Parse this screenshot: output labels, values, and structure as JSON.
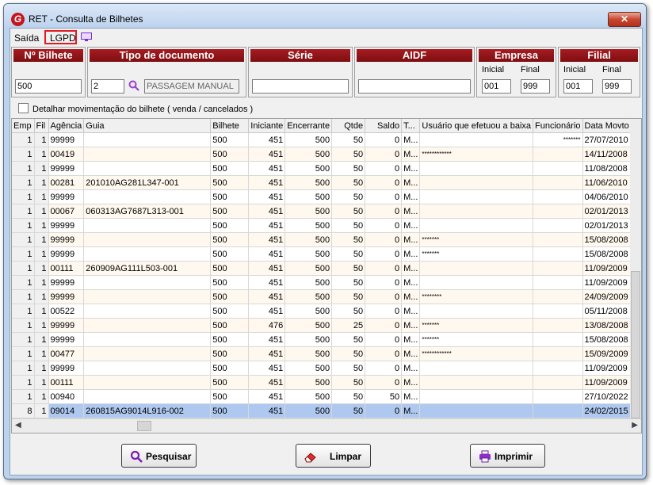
{
  "window": {
    "title": "RET - Consulta de Bilhetes",
    "close_label": "✕"
  },
  "menu": {
    "saida": "Saída",
    "lgpd": "LGPD"
  },
  "filters": {
    "bilhete": {
      "label": "Nº Bilhete",
      "value": "500"
    },
    "tipo_doc": {
      "label": "Tipo de documento",
      "code": "2",
      "description": "PASSAGEM MANUAL"
    },
    "serie": {
      "label": "Série",
      "value": ""
    },
    "aidf": {
      "label": "AIDF",
      "value": ""
    },
    "empresa": {
      "label": "Empresa",
      "inicial_label": "Inicial",
      "final_label": "Final",
      "inicial": "001",
      "final": "999"
    },
    "filial": {
      "label": "Filial",
      "inicial_label": "Inicial",
      "final_label": "Final",
      "inicial": "001",
      "final": "999"
    }
  },
  "detail_checkbox": {
    "label": "Detalhar movimentação do bilhete ( venda / cancelados )",
    "checked": false
  },
  "grid": {
    "columns": [
      "Emp",
      "Fil",
      "Agência",
      "Guia",
      "Bilhete",
      "Iniciante",
      "Encerrante",
      "Qtde",
      "Saldo",
      "T...",
      "Usuário que efetuou a baixa",
      "Funcionário",
      "Data Movto"
    ],
    "rows": [
      [
        "1",
        "1",
        "99999",
        "",
        "500",
        "451",
        "500",
        "50",
        "0",
        "M...",
        "",
        "*******",
        "27/07/2010"
      ],
      [
        "1",
        "1",
        "00419",
        "",
        "500",
        "451",
        "500",
        "50",
        "0",
        "M...",
        "************",
        "",
        "14/11/2008"
      ],
      [
        "1",
        "1",
        "99999",
        "",
        "500",
        "451",
        "500",
        "50",
        "0",
        "M...",
        "",
        "",
        "11/08/2008"
      ],
      [
        "1",
        "1",
        "00281",
        "201010AG281L347-001",
        "500",
        "451",
        "500",
        "50",
        "0",
        "M...",
        "",
        "",
        "11/06/2010"
      ],
      [
        "1",
        "1",
        "99999",
        "",
        "500",
        "451",
        "500",
        "50",
        "0",
        "M...",
        "",
        "",
        "04/06/2010"
      ],
      [
        "1",
        "1",
        "00067",
        "060313AG7687L313-001",
        "500",
        "451",
        "500",
        "50",
        "0",
        "M...",
        "",
        "",
        "02/01/2013"
      ],
      [
        "1",
        "1",
        "99999",
        "",
        "500",
        "451",
        "500",
        "50",
        "0",
        "M...",
        "",
        "",
        "02/01/2013"
      ],
      [
        "1",
        "1",
        "99999",
        "",
        "500",
        "451",
        "500",
        "50",
        "0",
        "M...",
        "*******",
        "",
        "15/08/2008"
      ],
      [
        "1",
        "1",
        "99999",
        "",
        "500",
        "451",
        "500",
        "50",
        "0",
        "M...",
        "*******",
        "",
        "15/08/2008"
      ],
      [
        "1",
        "1",
        "00111",
        "260909AG111L503-001",
        "500",
        "451",
        "500",
        "50",
        "0",
        "M...",
        "",
        "",
        "11/09/2009"
      ],
      [
        "1",
        "1",
        "99999",
        "",
        "500",
        "451",
        "500",
        "50",
        "0",
        "M...",
        "",
        "",
        "11/09/2009"
      ],
      [
        "1",
        "1",
        "99999",
        "",
        "500",
        "451",
        "500",
        "50",
        "0",
        "M...",
        "********",
        "",
        "24/09/2009"
      ],
      [
        "1",
        "1",
        "00522",
        "",
        "500",
        "451",
        "500",
        "50",
        "0",
        "M...",
        "",
        "",
        "05/11/2008"
      ],
      [
        "1",
        "1",
        "99999",
        "",
        "500",
        "476",
        "500",
        "25",
        "0",
        "M...",
        "*******",
        "",
        "13/08/2008"
      ],
      [
        "1",
        "1",
        "99999",
        "",
        "500",
        "451",
        "500",
        "50",
        "0",
        "M...",
        "*******",
        "",
        "15/08/2008"
      ],
      [
        "1",
        "1",
        "00477",
        "",
        "500",
        "451",
        "500",
        "50",
        "0",
        "M...",
        "************",
        "",
        "15/09/2009"
      ],
      [
        "1",
        "1",
        "99999",
        "",
        "500",
        "451",
        "500",
        "50",
        "0",
        "M...",
        "",
        "",
        "11/09/2009"
      ],
      [
        "1",
        "1",
        "00111",
        "",
        "500",
        "451",
        "500",
        "50",
        "0",
        "M...",
        "",
        "",
        "11/09/2009"
      ],
      [
        "1",
        "1",
        "00940",
        "",
        "500",
        "451",
        "500",
        "50",
        "50",
        "M...",
        "",
        "",
        "27/10/2022"
      ],
      [
        "8",
        "1",
        "09014",
        "260815AG9014L916-002",
        "500",
        "451",
        "500",
        "50",
        "0",
        "M...",
        "",
        "",
        "24/02/2015"
      ]
    ],
    "selected_row": 19
  },
  "buttons": {
    "pesquisar": "Pesquisar",
    "limpar": "Limpar",
    "imprimir": "Imprimir"
  },
  "colors": {
    "header_red": "#8b1418",
    "selection": "#aec8ef",
    "highlight_border": "#e21b23"
  }
}
